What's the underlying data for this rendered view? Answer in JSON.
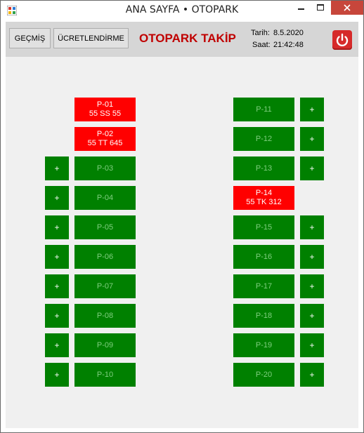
{
  "window": {
    "title": "ANA SAYFA • OTOPARK"
  },
  "toolbar": {
    "history_label": "GEÇMİŞ",
    "fees_label": "ÜCRETLENDİRME",
    "brand": "OTOPARK TAKİP",
    "date_label": "Tarih:",
    "date_value": "8.5.2020",
    "time_label": "Saat:",
    "time_value": "21:42:48"
  },
  "colors": {
    "occupied": "#ff0000",
    "free": "#008000",
    "brand": "#c00000"
  },
  "add_label": "+",
  "left_slots": [
    {
      "id": "P-01",
      "plate": "55 SS 55",
      "occupied": true
    },
    {
      "id": "P-02",
      "plate": "55 TT 645",
      "occupied": true
    },
    {
      "id": "P-03",
      "plate": "",
      "occupied": false
    },
    {
      "id": "P-04",
      "plate": "",
      "occupied": false
    },
    {
      "id": "P-05",
      "plate": "",
      "occupied": false
    },
    {
      "id": "P-06",
      "plate": "",
      "occupied": false
    },
    {
      "id": "P-07",
      "plate": "",
      "occupied": false
    },
    {
      "id": "P-08",
      "plate": "",
      "occupied": false
    },
    {
      "id": "P-09",
      "plate": "",
      "occupied": false
    },
    {
      "id": "P-10",
      "plate": "",
      "occupied": false
    }
  ],
  "right_slots": [
    {
      "id": "P-11",
      "plate": "",
      "occupied": false
    },
    {
      "id": "P-12",
      "plate": "",
      "occupied": false
    },
    {
      "id": "P-13",
      "plate": "",
      "occupied": false
    },
    {
      "id": "P-14",
      "plate": "55 TK 312",
      "occupied": true
    },
    {
      "id": "P-15",
      "plate": "",
      "occupied": false
    },
    {
      "id": "P-16",
      "plate": "",
      "occupied": false
    },
    {
      "id": "P-17",
      "plate": "",
      "occupied": false
    },
    {
      "id": "P-18",
      "plate": "",
      "occupied": false
    },
    {
      "id": "P-19",
      "plate": "",
      "occupied": false
    },
    {
      "id": "P-20",
      "plate": "",
      "occupied": false
    }
  ]
}
